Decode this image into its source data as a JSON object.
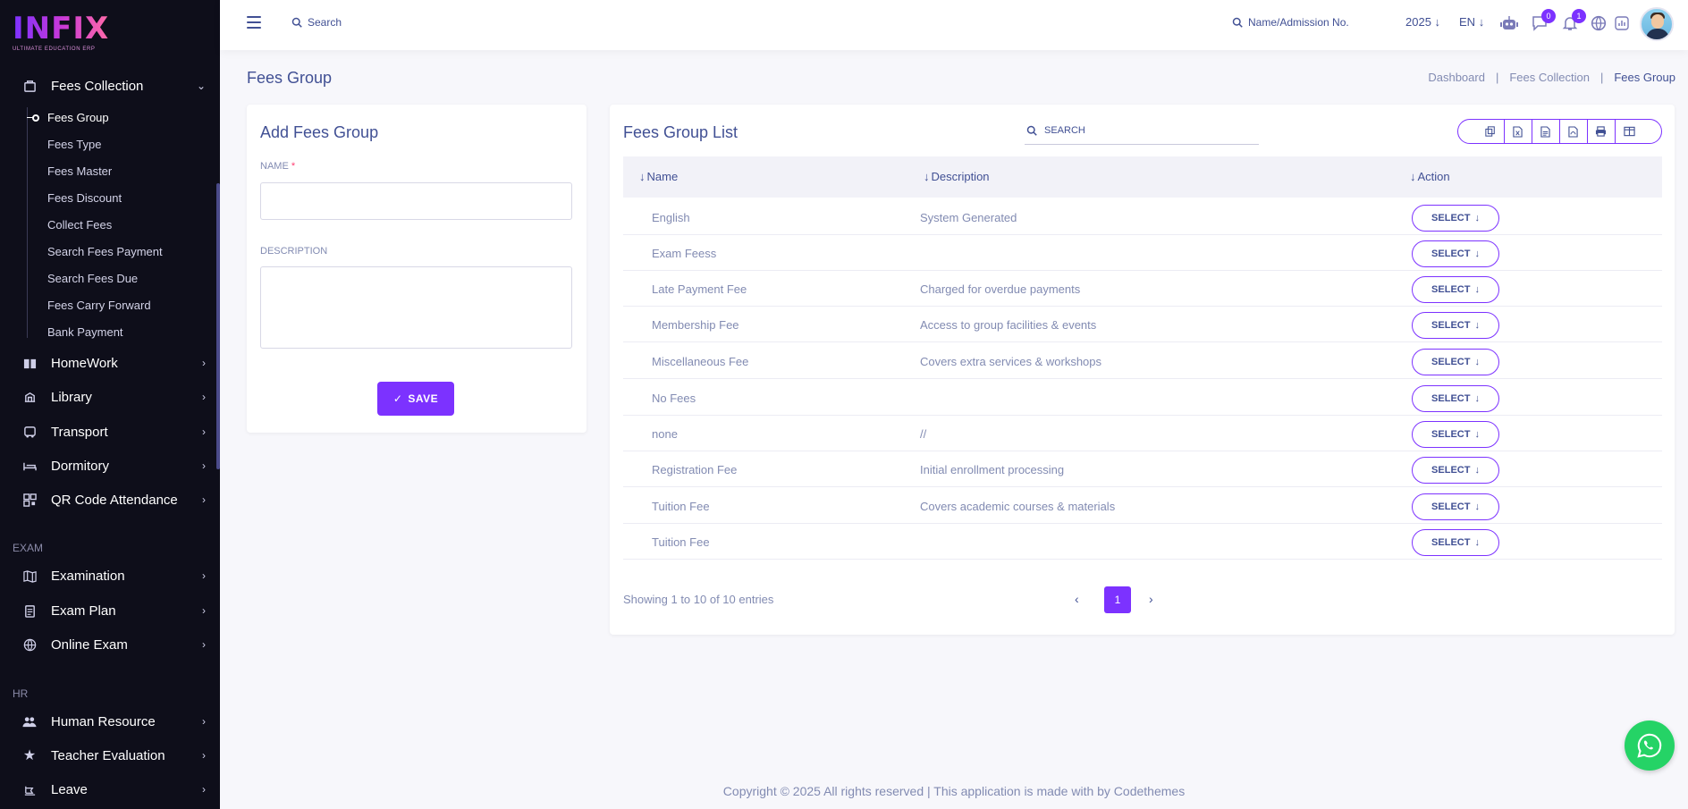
{
  "logo": {
    "mark": "INFIX",
    "tagline": "ULTIMATE EDUCATION ERP"
  },
  "sidebar": {
    "fees_collection": {
      "label": "Fees Collection",
      "icon": "wallet-icon"
    },
    "fees_sub": [
      "Fees Group",
      "Fees Type",
      "Fees Master",
      "Fees Discount",
      "Collect Fees",
      "Search Fees Payment",
      "Search Fees Due",
      "Fees Carry Forward",
      "Bank Payment"
    ],
    "group1": [
      {
        "label": "HomeWork",
        "icon": "book-icon"
      },
      {
        "label": "Library",
        "icon": "library-icon"
      },
      {
        "label": "Transport",
        "icon": "bus-icon"
      },
      {
        "label": "Dormitory",
        "icon": "bed-icon"
      },
      {
        "label": "QR Code Attendance",
        "icon": "qr-icon"
      }
    ],
    "section_exam": "EXAM",
    "group2": [
      {
        "label": "Examination",
        "icon": "map-icon"
      },
      {
        "label": "Exam Plan",
        "icon": "clipboard-icon"
      },
      {
        "label": "Online Exam",
        "icon": "globe-icon"
      }
    ],
    "section_hr": "HR",
    "group3": [
      {
        "label": "Human Resource",
        "icon": "users-icon"
      },
      {
        "label": "Teacher Evaluation",
        "icon": "star-icon"
      },
      {
        "label": "Leave",
        "icon": "leave-icon"
      }
    ]
  },
  "header": {
    "search_placeholder": "Search",
    "student_search": "Name/Admission No.",
    "year": "2025",
    "lang": "EN",
    "chat_count": "0",
    "notif_count": "1"
  },
  "page": {
    "title": "Fees Group",
    "breadcrumb": [
      "Dashboard",
      "Fees Collection",
      "Fees Group"
    ]
  },
  "form": {
    "title": "Add Fees Group",
    "name_label": "NAME",
    "required_mark": "*",
    "description_label": "DESCRIPTION",
    "save_label": "SAVE"
  },
  "list": {
    "title": "Fees Group List",
    "search_placeholder": "SEARCH",
    "columns": [
      "Name",
      "Description",
      "Action"
    ],
    "rows": [
      {
        "name": "English",
        "description": "System Generated",
        "action": "SELECT"
      },
      {
        "name": "Exam Feess",
        "description": "",
        "action": "SELECT"
      },
      {
        "name": "Late Payment Fee",
        "description": "Charged for overdue payments",
        "action": "SELECT"
      },
      {
        "name": "Membership Fee",
        "description": "Access to group facilities & events",
        "action": "SELECT"
      },
      {
        "name": "Miscellaneous Fee",
        "description": "Covers extra services & workshops",
        "action": "SELECT"
      },
      {
        "name": "No Fees",
        "description": "",
        "action": "SELECT"
      },
      {
        "name": "none",
        "description": "//",
        "action": "SELECT"
      },
      {
        "name": "Registration Fee",
        "description": "Initial enrollment processing",
        "action": "SELECT"
      },
      {
        "name": "Tuition Fee",
        "description": "Covers academic courses & materials",
        "action": "SELECT"
      },
      {
        "name": "Tuition Fee",
        "description": "",
        "action": "SELECT"
      }
    ],
    "showing": "Showing 1 to 10 of 10 entries",
    "current_page": "1",
    "export_icons": [
      "copy-icon",
      "excel-icon",
      "csv-icon",
      "pdf-icon",
      "print-icon",
      "columns-icon"
    ]
  },
  "footer": "Copyright © 2025 All rights reserved | This application is made with by Codethemes",
  "colors": {
    "accent": "#7c32ff",
    "text": "#415094",
    "muted": "#828bb2",
    "sidebar_bg": "#0e0e1a",
    "whatsapp": "#25d366"
  }
}
